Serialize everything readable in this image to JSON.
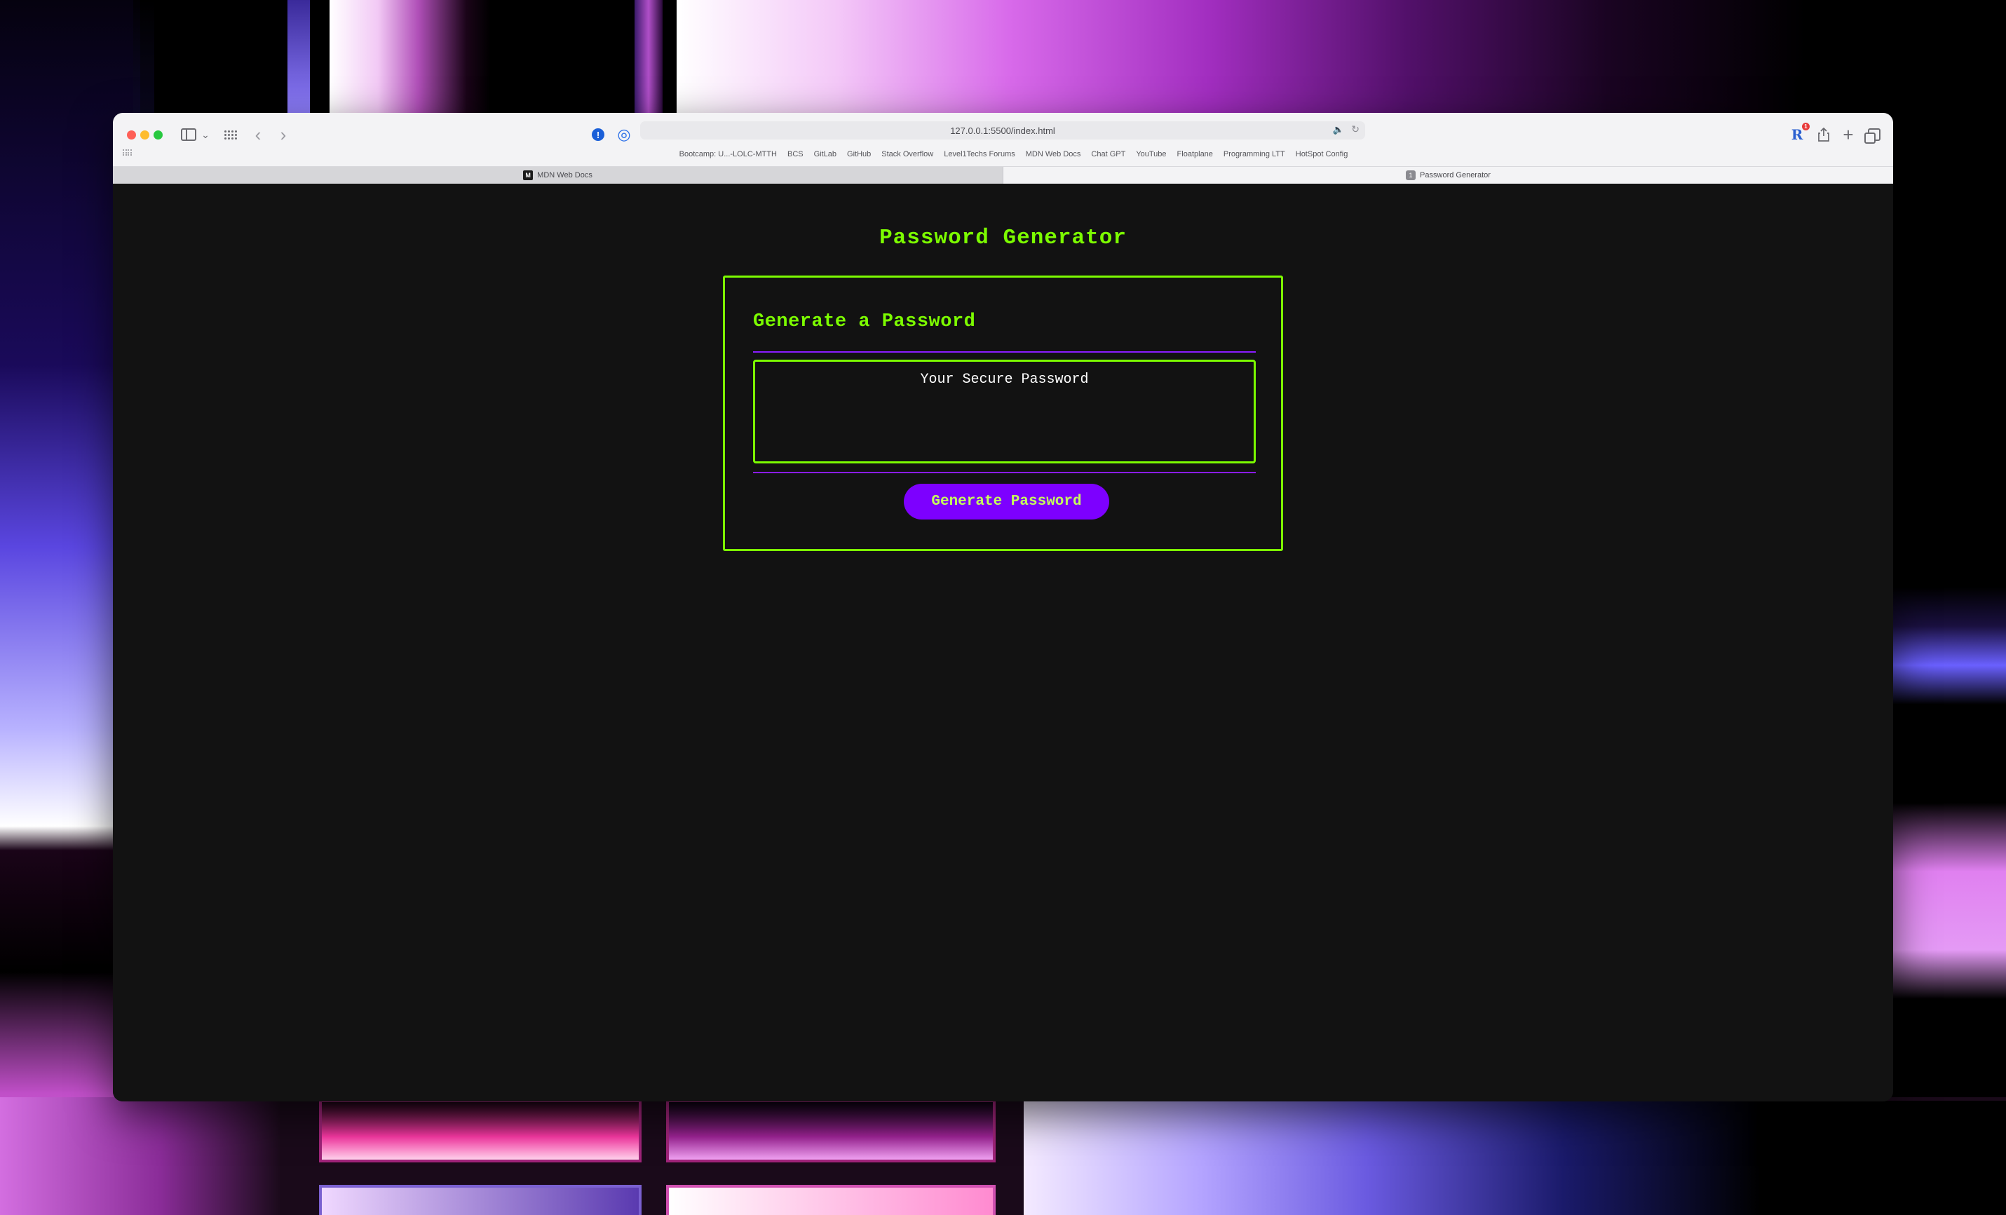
{
  "browser": {
    "url": "127.0.0.1:5500/index.html",
    "bookmarks": [
      "Bootcamp: U...-LOLC-MTTH",
      "BCS",
      "GitLab",
      "GitHub",
      "Stack Overflow",
      "Level1Techs Forums",
      "MDN Web Docs",
      "Chat GPT",
      "YouTube",
      "Floatplane",
      "Programming LTT",
      "HotSpot Config"
    ],
    "tabs": [
      {
        "label": "MDN Web Docs",
        "icon": "M",
        "active": false
      },
      {
        "label": "Password Generator",
        "icon": "1",
        "active": true
      }
    ],
    "extension_badge": "1",
    "extension_letter": "R",
    "icons": {
      "ext1": "!"
    }
  },
  "page": {
    "title": "Password Generator",
    "card_heading": "Generate a Password",
    "password_placeholder": "Your Secure Password",
    "button_label": "Generate Password"
  },
  "colors": {
    "accent_green": "#7cfc00",
    "accent_purple": "#7d00ff",
    "page_background": "#121212"
  }
}
